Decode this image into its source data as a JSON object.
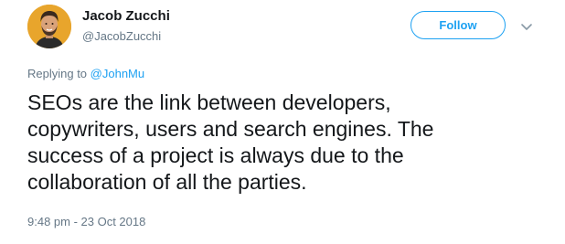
{
  "author": {
    "name": "Jacob Zucchi",
    "handle": "@JacobZucchi",
    "avatar_icon": "profile-photo"
  },
  "actions": {
    "follow_label": "Follow",
    "more_icon": "chevron-down-icon"
  },
  "reply": {
    "prefix": "Replying to",
    "target": "@JohnMu"
  },
  "tweet": {
    "lines": [
      "SEOs are the link between developers,",
      "copywriters, users and search engines. The",
      "success of a project is always due to the",
      "collaboration of all the parties."
    ],
    "timestamp": "9:48 pm - 23 Oct 2018"
  },
  "colors": {
    "accent": "#1da1f2",
    "text": "#14171a",
    "secondary": "#657786",
    "avatar_bg": "#e8a52c"
  }
}
